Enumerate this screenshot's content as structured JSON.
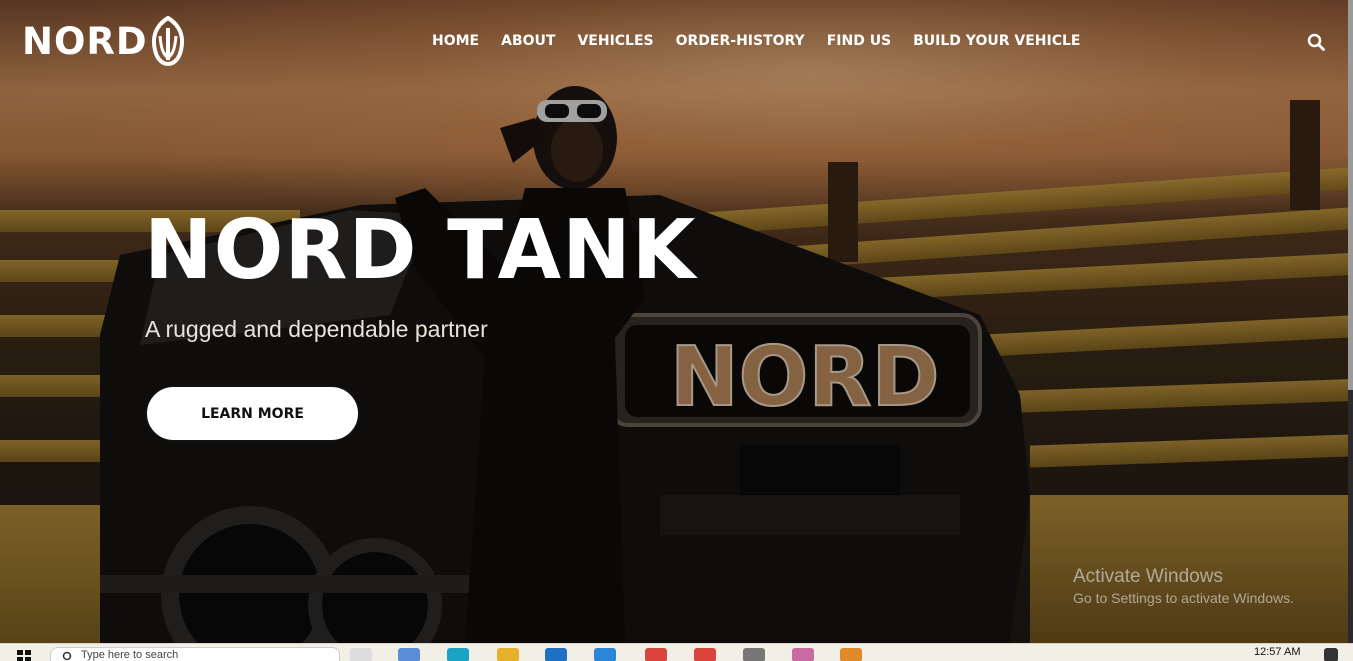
{
  "brand": {
    "name": "NORD"
  },
  "nav": {
    "items": [
      {
        "label": "HOME"
      },
      {
        "label": "ABOUT"
      },
      {
        "label": "VEHICLES"
      },
      {
        "label": "ORDER-HISTORY"
      },
      {
        "label": "FIND US"
      },
      {
        "label": "BUILD YOUR VEHICLE"
      }
    ],
    "search_icon": "search-icon"
  },
  "hero": {
    "title": "NORD TANK",
    "subtitle": "A rugged and dependable partner",
    "cta_label": "LEARN MORE",
    "grille_text": "NORD"
  },
  "watermark": {
    "title": "Activate Windows",
    "subtitle": "Go to Settings to activate Windows."
  },
  "taskbar": {
    "search_placeholder": "Type here to search",
    "time": "12:57 AM"
  },
  "colors": {
    "accent": "#ffffff",
    "button_bg": "#ffffff",
    "button_text": "#111111"
  }
}
